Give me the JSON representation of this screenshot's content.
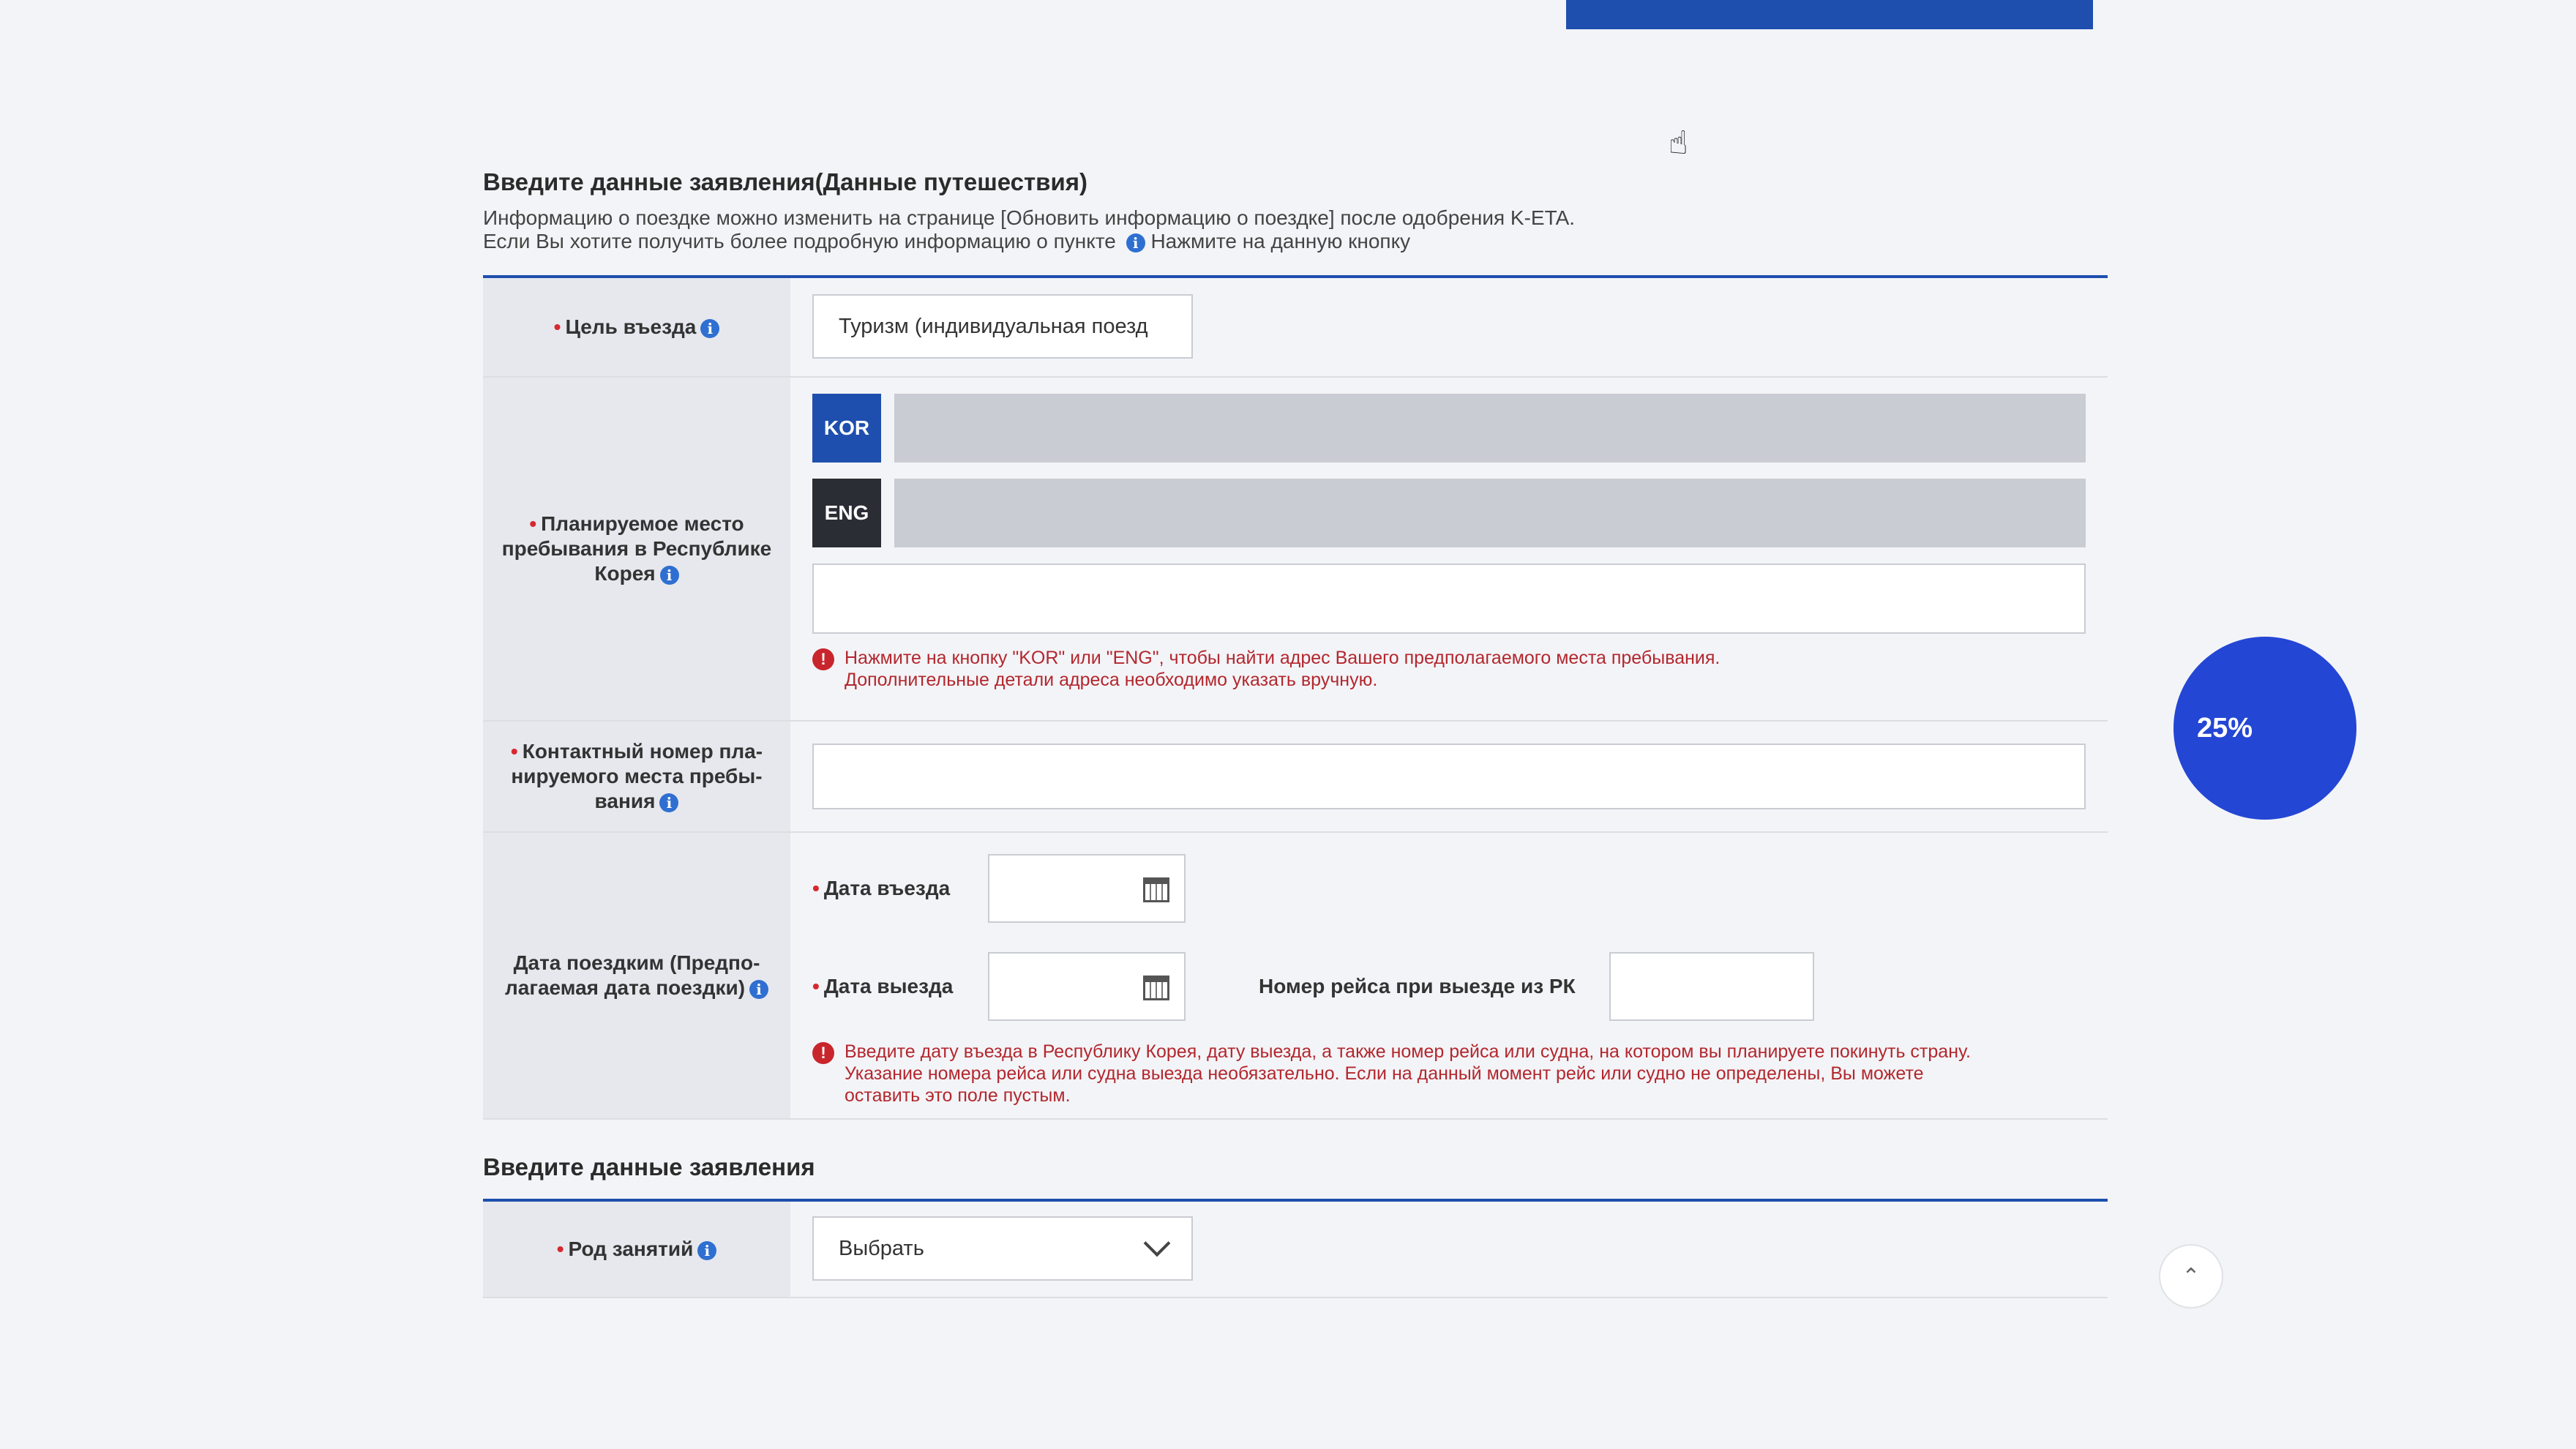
{
  "section_travel": {
    "title": "Введите данные заявления(Данные путешествия)",
    "intro_line1": "Информацию о поездке можно изменить на странице [Обновить информацию о поездке] после одобрения K-ETA.",
    "intro_line2_a": "Если Вы хотите получить более подробную информацию о пункте",
    "intro_line2_b": "Нажмите на данную кнопку"
  },
  "purpose": {
    "label": "Цель въезда",
    "value": "Туризм (индивидуальная поезд"
  },
  "stay_place": {
    "label": "Планируемое место пребывания в Республике Корея",
    "kor_button": "KOR",
    "eng_button": "ENG",
    "warning_line1": "Нажмите на кнопку \"KOR\" или \"ENG\", чтобы найти адрес Вашего предполагаемого места пребывания.",
    "warning_line2": "Дополнительные детали адреса необходимо указать вручную."
  },
  "contact_phone": {
    "label": "Контактный номер пла-нируемого места пребы-вания"
  },
  "trip_dates": {
    "label": "Дата поездким (Предпо-лагаемая дата поездки)",
    "entry_label": "Дата въезда",
    "exit_label": "Дата выезда",
    "flight_label": "Номер рейса при выезде из РК",
    "warning_line1": "Введите дату въезда в Республику Корея, дату выезда, а также номер рейса или судна, на котором вы планируете покинуть страну.",
    "warning_line2": "Указание номера рейса или судна выезда необязательно. Если на данный момент рейс или судно не определены, Вы можете",
    "warning_line3": "оставить это поле пустым."
  },
  "section_application": {
    "title": "Введите данные заявления"
  },
  "occupation": {
    "label": "Род занятий",
    "select_value": "Выбрать"
  },
  "progress": {
    "percent_label": "25%",
    "value": 0.25
  },
  "icons": [
    "info-icon",
    "warning-icon",
    "calendar-icon",
    "chevron-down-icon",
    "scroll-top-icon",
    "hand-cursor-icon"
  ],
  "colors": {
    "accent": "#1e4fae",
    "progress": "#2346d4",
    "warning": "#c8262c",
    "label_bg": "#e6e8ee"
  }
}
